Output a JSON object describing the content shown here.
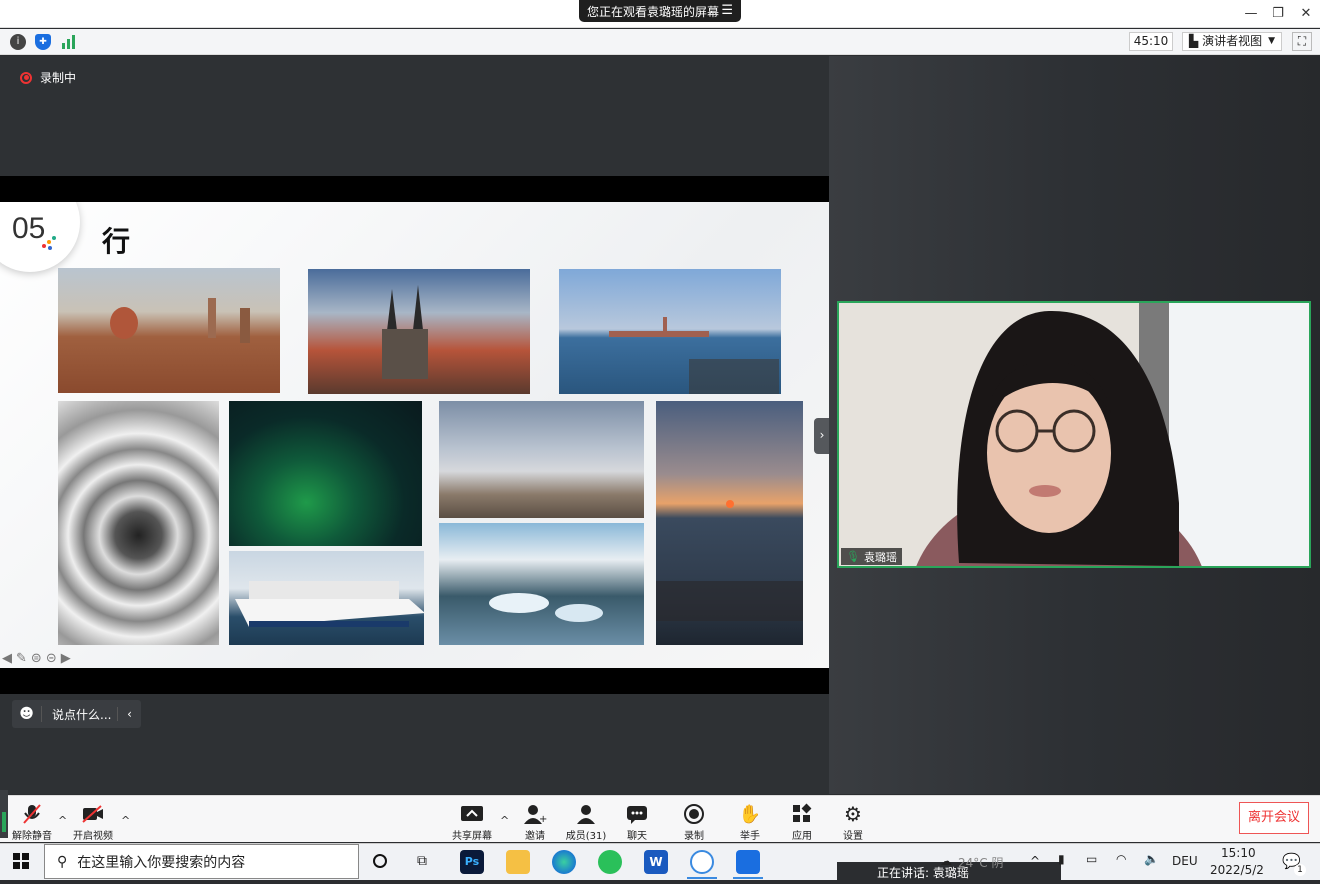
{
  "titlebar": {
    "share_notice": "您正在观看袁璐瑶的屏幕"
  },
  "infobar": {
    "timer": "45:10",
    "view_mode": "演讲者视图"
  },
  "recording": {
    "label": "录制中"
  },
  "slide": {
    "number": "05",
    "title": "行"
  },
  "chat": {
    "placeholder": "说点什么..."
  },
  "participant": {
    "name": "袁璐瑶"
  },
  "toolbar": {
    "unmute": "解除静音",
    "start_video": "开启视频",
    "share_screen": "共享屏幕",
    "invite": "邀请",
    "members": "成员(31)",
    "chat": "聊天",
    "record": "录制",
    "raise_hand": "举手",
    "apps": "应用",
    "settings": "设置",
    "leave": "离开会议"
  },
  "taskbar": {
    "search_placeholder": "在这里输入你要搜索的内容",
    "speaking": "正在讲话: 袁璐瑶",
    "weather": "24°C 阴",
    "language": "DEU",
    "time": "15:10",
    "date": "2022/5/2",
    "notification_count": "1"
  },
  "colors": {
    "accent_green": "#2aa55a",
    "leave_red": "#e33333",
    "rec_red": "#e33333"
  }
}
